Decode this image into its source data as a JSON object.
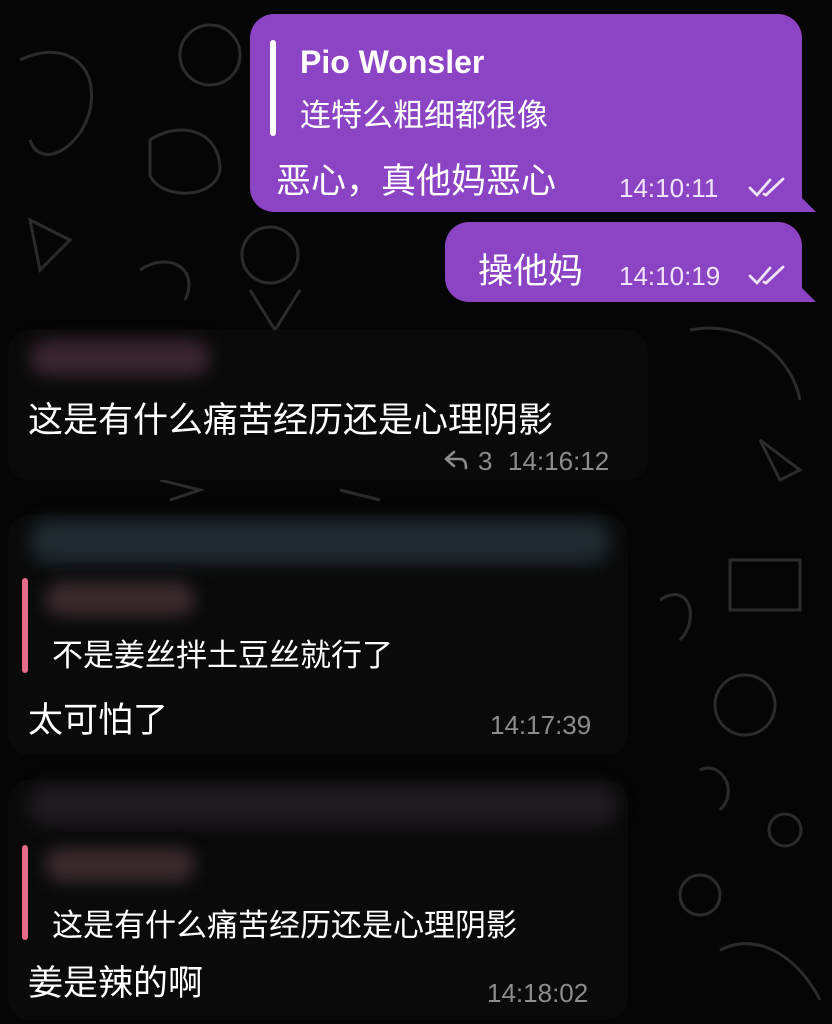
{
  "messages": {
    "out1": {
      "reply_name": "Pio Wonsler",
      "reply_text": "连特么粗细都很像",
      "text": "恶心，真他妈恶心",
      "time": "14:10:11"
    },
    "out2": {
      "text": "操他妈",
      "time": "14:10:19"
    },
    "in1": {
      "text": "这是有什么痛苦经历还是心理阴影",
      "reply_count": "3",
      "time": "14:16:12"
    },
    "in2": {
      "reply_text": "不是姜丝拌土豆丝就行了",
      "text": "太可怕了",
      "time": "14:17:39"
    },
    "in3": {
      "reply_text": "这是有什么痛苦经历还是心理阴影",
      "text": "姜是辣的啊",
      "time": "14:18:02"
    }
  },
  "colors": {
    "outgoing_bubble": "#8a44c4",
    "reply_accent": "#e56b8a",
    "background": "#050505"
  }
}
